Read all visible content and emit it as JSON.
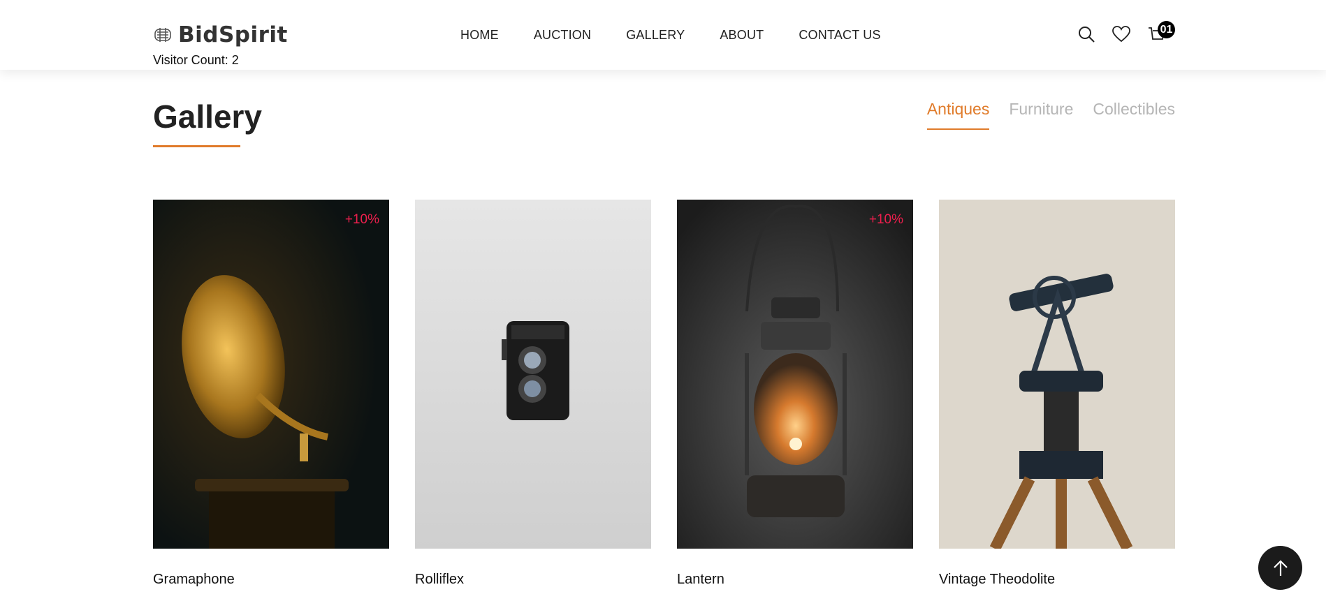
{
  "brand": {
    "name": "BidSpirit",
    "visitor_count": "Visitor Count: 2"
  },
  "nav": [
    "HOME",
    "AUCTION",
    "GALLERY",
    "ABOUT",
    "CONTACT US"
  ],
  "header_icons": {
    "search": "search-icon",
    "wishlist": "heart-icon",
    "cart": "cart-icon",
    "cart_count": "01"
  },
  "page": {
    "title": "Gallery"
  },
  "tabs": [
    {
      "label": "Antiques",
      "active": true
    },
    {
      "label": "Furniture",
      "active": false
    },
    {
      "label": "Collectibles",
      "active": false
    }
  ],
  "products": [
    {
      "name": "Gramaphone",
      "badge": "+10%"
    },
    {
      "name": "Rolliflex",
      "badge": ""
    },
    {
      "name": "Lantern",
      "badge": "+10%"
    },
    {
      "name": "Vintage Theodolite",
      "badge": ""
    }
  ],
  "colors": {
    "accent": "#e07b2a",
    "badge": "#ee1f4d",
    "tab_inactive": "#b5b5b5"
  },
  "back_to_top": "arrow-up-icon"
}
